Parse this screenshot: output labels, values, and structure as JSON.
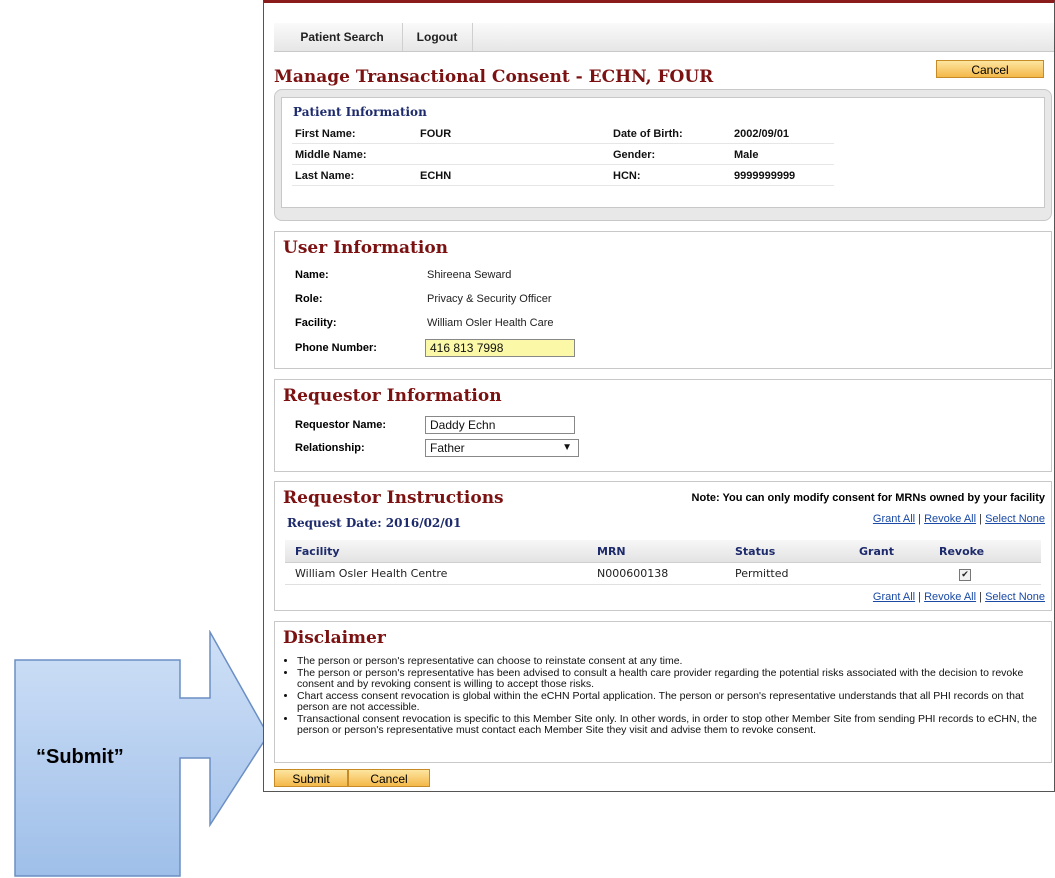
{
  "nav": {
    "tabs": [
      "Patient Search",
      "Logout"
    ]
  },
  "page": {
    "title": "Manage Transactional Consent - ECHN, FOUR",
    "cancel_label": "Cancel"
  },
  "patient": {
    "heading": "Patient Information",
    "first_name_label": "First Name:",
    "first_name": "FOUR",
    "middle_name_label": "Middle Name:",
    "middle_name": "",
    "last_name_label": "Last Name:",
    "last_name": "ECHN",
    "dob_label": "Date of Birth:",
    "dob": "2002/09/01",
    "gender_label": "Gender:",
    "gender": "Male",
    "hcn_label": "HCN:",
    "hcn": "9999999999"
  },
  "user": {
    "heading": "User Information",
    "name_label": "Name:",
    "name": "Shireena Seward",
    "role_label": "Role:",
    "role": "Privacy & Security Officer",
    "facility_label": "Facility:",
    "facility": "William Osler Health Care",
    "phone_label": "Phone Number:",
    "phone": "416 813 7998"
  },
  "requestor": {
    "heading": "Requestor Information",
    "name_label": "Requestor Name:",
    "name": "Daddy Echn",
    "relationship_label": "Relationship:",
    "relationship": "Father"
  },
  "instructions": {
    "heading": "Requestor Instructions",
    "note": "Note: You can only modify consent for MRNs owned by your facility",
    "request_date": "Request Date: 2016/02/01",
    "links": {
      "grant_all": "Grant All",
      "revoke_all": "Revoke All",
      "select_none": "Select None",
      "sep": "|"
    },
    "columns": [
      "Facility",
      "MRN",
      "Status",
      "Grant",
      "Revoke"
    ],
    "rows": [
      {
        "facility": "William Osler Health Centre",
        "mrn": "N000600138",
        "status": "Permitted",
        "grant": "",
        "revoke_checked": true
      }
    ]
  },
  "disclaimer": {
    "heading": "Disclaimer",
    "items": [
      "The person or person's representative can choose to reinstate consent at any time.",
      "The person or person's representative has been advised to consult a health care provider regarding the potential risks associated with the decision to revoke consent and by revoking consent is willing to accept those risks.",
      "Chart access consent revocation is global within the eCHN Portal application. The person or person's representative understands that all PHI records on that person are not accessible.",
      "Transactional consent revocation is specific to this Member Site only. In other words, in order to stop other Member Site from sending PHI records to eCHN, the person or person's representative must contact each Member Site they visit and advise them to revoke consent."
    ]
  },
  "actions": {
    "submit_label": "Submit",
    "cancel_label": "Cancel"
  },
  "callout": {
    "label": "“Submit”",
    "fill": "#b9d3f3",
    "stroke": "#6b8fc4"
  },
  "colors": {
    "brand": "#7b1111",
    "button": "#f4b84a",
    "heading_blue": "#1d2a6b",
    "phone_highlight": "#fbf9a7"
  }
}
